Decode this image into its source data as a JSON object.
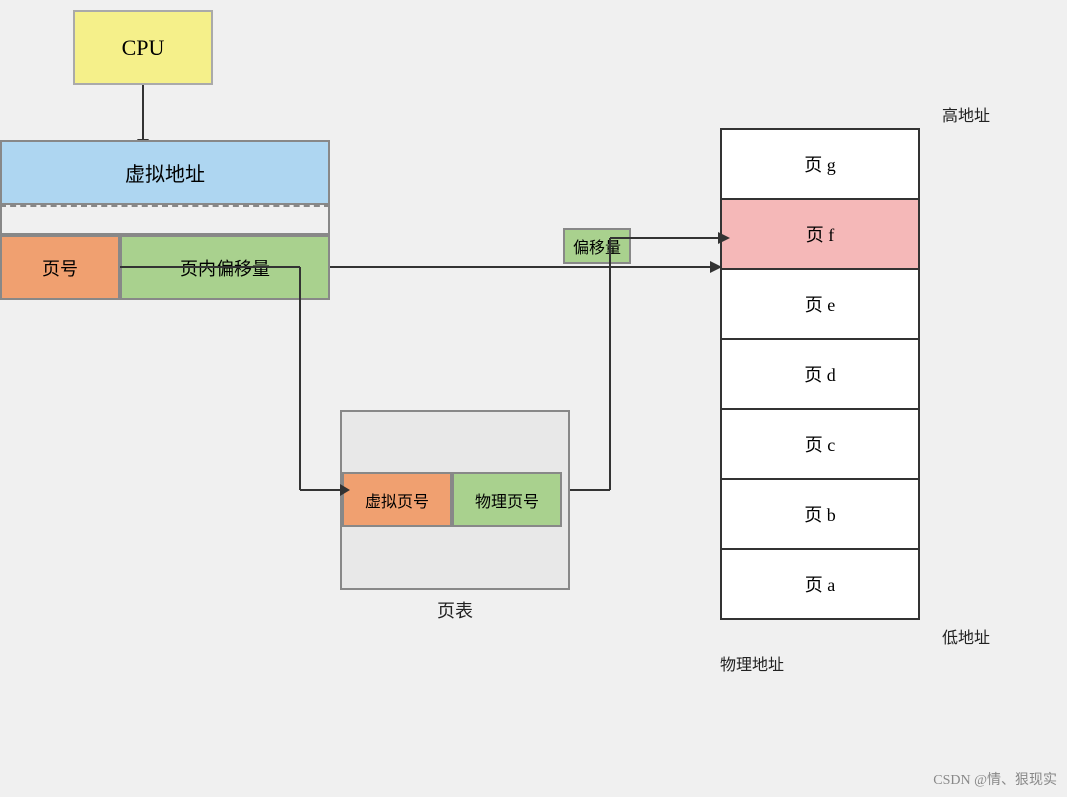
{
  "cpu": {
    "label": "CPU"
  },
  "virtual_address": {
    "label": "虚拟地址"
  },
  "page_number": {
    "label": "页号"
  },
  "page_offset": {
    "label": "页内偏移量"
  },
  "page_table": {
    "label": "页表",
    "virt_label": "虚拟页号",
    "phys_label": "物理页号"
  },
  "offset_badge": {
    "label": "偏移量"
  },
  "physical_memory": {
    "label": "物理地址",
    "high_label": "高地址",
    "low_label": "低地址",
    "cells": [
      {
        "label": "页 g",
        "highlighted": false
      },
      {
        "label": "页 f",
        "highlighted": true
      },
      {
        "label": "页 e",
        "highlighted": false
      },
      {
        "label": "页 d",
        "highlighted": false
      },
      {
        "label": "页 c",
        "highlighted": false
      },
      {
        "label": "页 b",
        "highlighted": false
      },
      {
        "label": "页 a",
        "highlighted": false
      }
    ]
  },
  "watermark": {
    "text": "CSDN @情、狠现实"
  }
}
